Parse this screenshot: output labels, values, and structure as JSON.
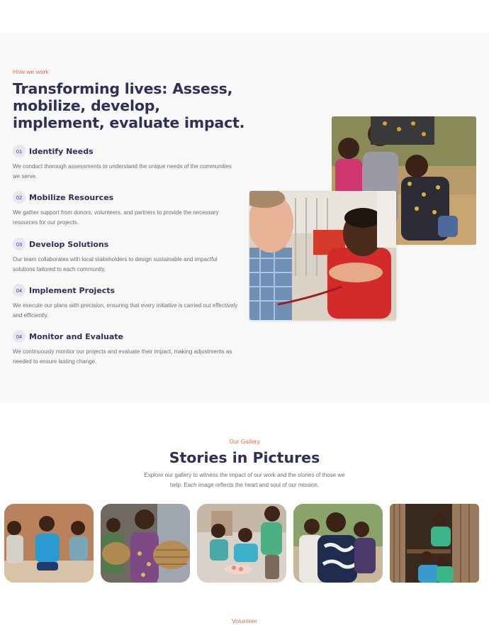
{
  "how_we_work": {
    "eyebrow": "How we work",
    "title": "Transforming lives: Assess, mobilize, develop, implement, evaluate impact.",
    "steps": [
      {
        "number": "01",
        "title": "Identify Needs",
        "description": "We conduct thorough assessments to understand the unique needs of the communities we serve."
      },
      {
        "number": "02",
        "title": "Mobilize Resources",
        "description": "We gather support from donors, volunteers, and partners to provide the necessary resources for our projects."
      },
      {
        "number": "03",
        "title": "Develop Solutions",
        "description": "Our team collaborates with local stakeholders to design sustainable and impactful solutions tailored to each community."
      },
      {
        "number": "04",
        "title": "Implement Projects",
        "description": "We execute our plans with precision, ensuring that every initiative is carried out effectively and efficiently."
      },
      {
        "number": "04",
        "title": "Monitor and Evaluate",
        "description": "We continuously monitor our projects and evaluate their impact, making adjustments as needed to ensure lasting change."
      }
    ],
    "photos": [
      "children-group-photo",
      "doctor-child-photo"
    ]
  },
  "gallery": {
    "eyebrow": "Our Gallery",
    "title": "Stories in Pictures",
    "description": "Explore our gallery to witness the impact of our work and the stories of those we help. Each image reflects the heart and soul of our mission.",
    "images": [
      "boys-sitting-photo",
      "girl-with-basket-photo",
      "children-playing-photo",
      "children-embracing-photo",
      "children-doorway-photo"
    ]
  },
  "volunteer": {
    "eyebrow": "Volunteer"
  },
  "colors": {
    "accent": "#e0703f",
    "heading": "#2e3055",
    "body_text": "#6d6d78",
    "section_bg": "#f8f8f9",
    "number_badge_bg": "#e6e6f5"
  }
}
